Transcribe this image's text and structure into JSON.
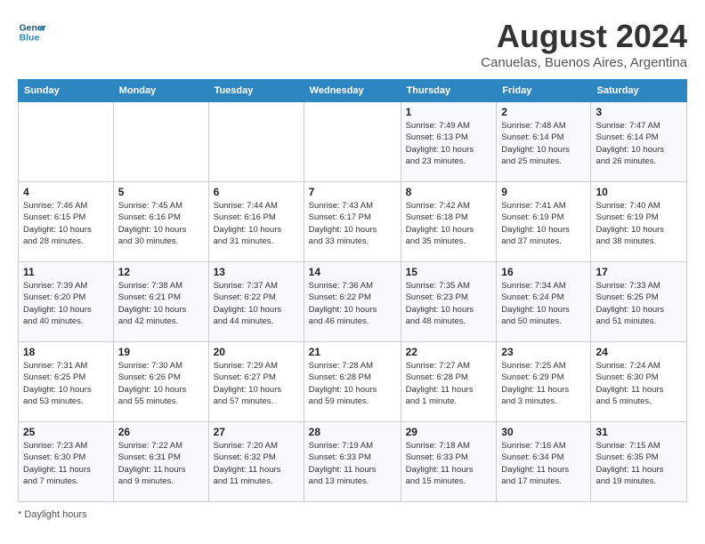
{
  "header": {
    "logo_line1": "General",
    "logo_line2": "Blue",
    "month_year": "August 2024",
    "location": "Canuelas, Buenos Aires, Argentina"
  },
  "days_of_week": [
    "Sunday",
    "Monday",
    "Tuesday",
    "Wednesday",
    "Thursday",
    "Friday",
    "Saturday"
  ],
  "weeks": [
    [
      {
        "day": "",
        "info": ""
      },
      {
        "day": "",
        "info": ""
      },
      {
        "day": "",
        "info": ""
      },
      {
        "day": "",
        "info": ""
      },
      {
        "day": "1",
        "info": "Sunrise: 7:49 AM\nSunset: 6:13 PM\nDaylight: 10 hours\nand 23 minutes."
      },
      {
        "day": "2",
        "info": "Sunrise: 7:48 AM\nSunset: 6:14 PM\nDaylight: 10 hours\nand 25 minutes."
      },
      {
        "day": "3",
        "info": "Sunrise: 7:47 AM\nSunset: 6:14 PM\nDaylight: 10 hours\nand 26 minutes."
      }
    ],
    [
      {
        "day": "4",
        "info": "Sunrise: 7:46 AM\nSunset: 6:15 PM\nDaylight: 10 hours\nand 28 minutes."
      },
      {
        "day": "5",
        "info": "Sunrise: 7:45 AM\nSunset: 6:16 PM\nDaylight: 10 hours\nand 30 minutes."
      },
      {
        "day": "6",
        "info": "Sunrise: 7:44 AM\nSunset: 6:16 PM\nDaylight: 10 hours\nand 31 minutes."
      },
      {
        "day": "7",
        "info": "Sunrise: 7:43 AM\nSunset: 6:17 PM\nDaylight: 10 hours\nand 33 minutes."
      },
      {
        "day": "8",
        "info": "Sunrise: 7:42 AM\nSunset: 6:18 PM\nDaylight: 10 hours\nand 35 minutes."
      },
      {
        "day": "9",
        "info": "Sunrise: 7:41 AM\nSunset: 6:19 PM\nDaylight: 10 hours\nand 37 minutes."
      },
      {
        "day": "10",
        "info": "Sunrise: 7:40 AM\nSunset: 6:19 PM\nDaylight: 10 hours\nand 38 minutes."
      }
    ],
    [
      {
        "day": "11",
        "info": "Sunrise: 7:39 AM\nSunset: 6:20 PM\nDaylight: 10 hours\nand 40 minutes."
      },
      {
        "day": "12",
        "info": "Sunrise: 7:38 AM\nSunset: 6:21 PM\nDaylight: 10 hours\nand 42 minutes."
      },
      {
        "day": "13",
        "info": "Sunrise: 7:37 AM\nSunset: 6:22 PM\nDaylight: 10 hours\nand 44 minutes."
      },
      {
        "day": "14",
        "info": "Sunrise: 7:36 AM\nSunset: 6:22 PM\nDaylight: 10 hours\nand 46 minutes."
      },
      {
        "day": "15",
        "info": "Sunrise: 7:35 AM\nSunset: 6:23 PM\nDaylight: 10 hours\nand 48 minutes."
      },
      {
        "day": "16",
        "info": "Sunrise: 7:34 AM\nSunset: 6:24 PM\nDaylight: 10 hours\nand 50 minutes."
      },
      {
        "day": "17",
        "info": "Sunrise: 7:33 AM\nSunset: 6:25 PM\nDaylight: 10 hours\nand 51 minutes."
      }
    ],
    [
      {
        "day": "18",
        "info": "Sunrise: 7:31 AM\nSunset: 6:25 PM\nDaylight: 10 hours\nand 53 minutes."
      },
      {
        "day": "19",
        "info": "Sunrise: 7:30 AM\nSunset: 6:26 PM\nDaylight: 10 hours\nand 55 minutes."
      },
      {
        "day": "20",
        "info": "Sunrise: 7:29 AM\nSunset: 6:27 PM\nDaylight: 10 hours\nand 57 minutes."
      },
      {
        "day": "21",
        "info": "Sunrise: 7:28 AM\nSunset: 6:28 PM\nDaylight: 10 hours\nand 59 minutes."
      },
      {
        "day": "22",
        "info": "Sunrise: 7:27 AM\nSunset: 6:28 PM\nDaylight: 11 hours\nand 1 minute."
      },
      {
        "day": "23",
        "info": "Sunrise: 7:25 AM\nSunset: 6:29 PM\nDaylight: 11 hours\nand 3 minutes."
      },
      {
        "day": "24",
        "info": "Sunrise: 7:24 AM\nSunset: 6:30 PM\nDaylight: 11 hours\nand 5 minutes."
      }
    ],
    [
      {
        "day": "25",
        "info": "Sunrise: 7:23 AM\nSunset: 6:30 PM\nDaylight: 11 hours\nand 7 minutes."
      },
      {
        "day": "26",
        "info": "Sunrise: 7:22 AM\nSunset: 6:31 PM\nDaylight: 11 hours\nand 9 minutes."
      },
      {
        "day": "27",
        "info": "Sunrise: 7:20 AM\nSunset: 6:32 PM\nDaylight: 11 hours\nand 11 minutes."
      },
      {
        "day": "28",
        "info": "Sunrise: 7:19 AM\nSunset: 6:33 PM\nDaylight: 11 hours\nand 13 minutes."
      },
      {
        "day": "29",
        "info": "Sunrise: 7:18 AM\nSunset: 6:33 PM\nDaylight: 11 hours\nand 15 minutes."
      },
      {
        "day": "30",
        "info": "Sunrise: 7:16 AM\nSunset: 6:34 PM\nDaylight: 11 hours\nand 17 minutes."
      },
      {
        "day": "31",
        "info": "Sunrise: 7:15 AM\nSunset: 6:35 PM\nDaylight: 11 hours\nand 19 minutes."
      }
    ]
  ],
  "footer": {
    "note": "Daylight hours"
  }
}
